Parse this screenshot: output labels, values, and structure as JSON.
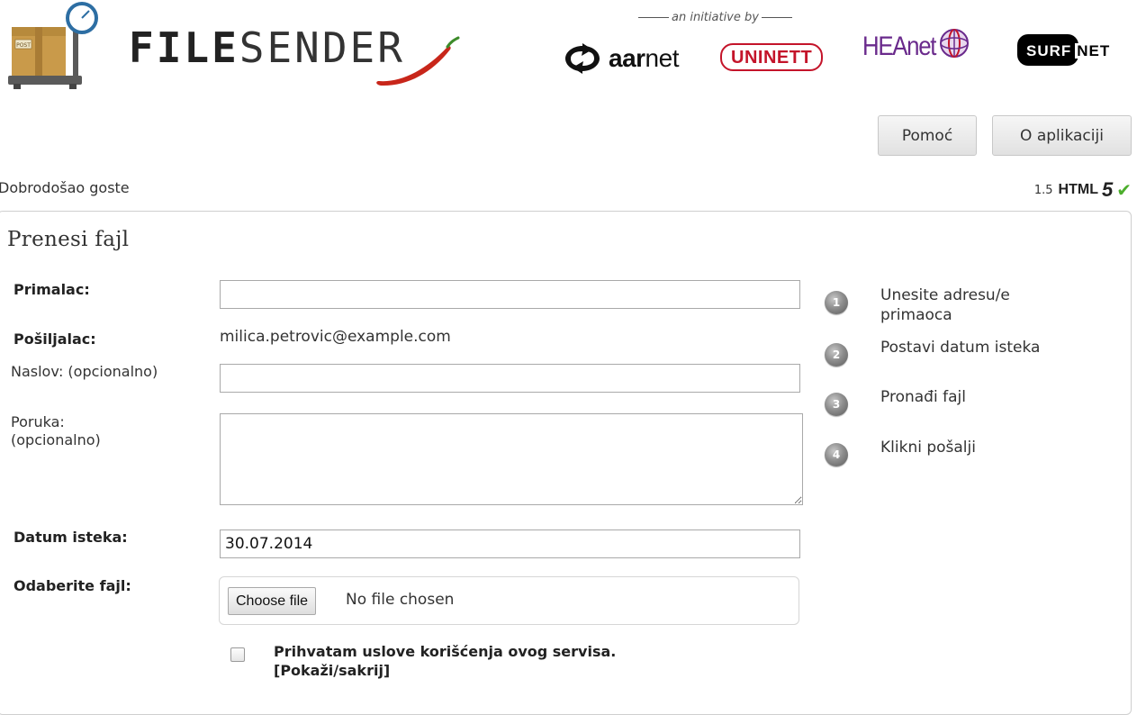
{
  "header": {
    "logo": {
      "label": "FILESENDER",
      "label_bold": "FILE",
      "label_light": "SENDER",
      "icon": "parcel-scale-icon",
      "box_stamp": "POST"
    },
    "initiative_label": "an initiative by",
    "partners": {
      "aarnet": "aarnet",
      "aarnet_bold": "aar",
      "aarnet_light": "net",
      "uninett": "UNINETT",
      "heanet": "HEAnet",
      "surfnet_box": "SURF",
      "surfnet_net": "NET"
    }
  },
  "nav": {
    "help_label": "Pomoć",
    "about_label": "O aplikaciji"
  },
  "welcome_text": "Dobrodošao goste",
  "version": {
    "number": "1.5",
    "html_label": "HTML",
    "five_label": "5",
    "check_icon": "checkmark-icon",
    "check_color": "#4cae2c"
  },
  "form": {
    "title": "Prenesi fajl",
    "recipient_label": "Primalac:",
    "recipient_value": "",
    "sender_label": "Pošiljalac:",
    "sender_value": "milica.petrovic@example.com",
    "subject_label": "Naslov: (opcionalno)",
    "subject_value": "",
    "message_label_line1": "Poruka:",
    "message_label_line2": "(opcionalno)",
    "message_value": "",
    "expiry_label": "Datum isteka:",
    "expiry_value": "30.07.2014",
    "file_label": "Odaberite fajl:",
    "choose_button": "Choose file",
    "no_file_text": "No file chosen",
    "terms_text": "Prihvatam uslove korišćenja ovog servisa.",
    "terms_toggle": "[Pokaži/sakrij]",
    "terms_checked": false
  },
  "steps": [
    {
      "number": "1",
      "text": "Unesite adresu/e primaoca"
    },
    {
      "number": "2",
      "text": "Postavi datum isteka"
    },
    {
      "number": "3",
      "text": "Pronađi fajl"
    },
    {
      "number": "4",
      "text": "Klikni pošalji"
    }
  ],
  "colors": {
    "uninett_red": "#c4142a",
    "heanet_purple": "#6a2a8c",
    "chili_red": "#c8261a"
  }
}
